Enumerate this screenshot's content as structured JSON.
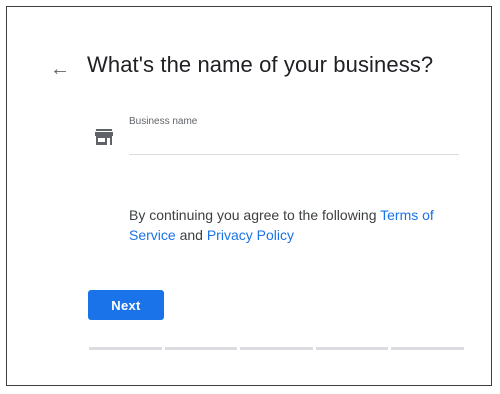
{
  "header": {
    "back_icon": "arrow-left-icon",
    "title": "What's the name of your business?"
  },
  "form": {
    "field_icon": "store-icon",
    "business_name_label": "Business name",
    "business_name_value": "",
    "business_name_placeholder": ""
  },
  "terms": {
    "prefix": "By continuing you agree to the following ",
    "terms_link": "Terms of Service",
    "conjunction": " and ",
    "privacy_link": "Privacy Policy"
  },
  "actions": {
    "next_label": "Next"
  },
  "progress": {
    "total_steps": 5,
    "completed_steps": 0
  },
  "colors": {
    "accent": "#1a73e8",
    "text_primary": "#202124",
    "text_secondary": "#5f6368",
    "divider": "#dadce0"
  }
}
